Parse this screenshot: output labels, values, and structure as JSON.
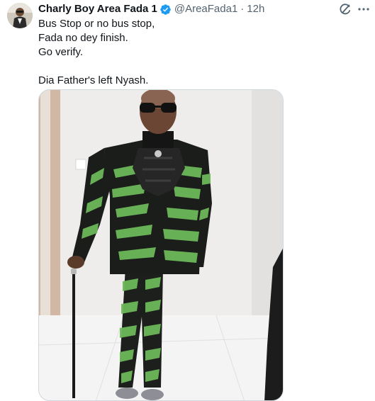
{
  "tweet": {
    "author_name": "Charly Boy Area Fada 1",
    "handle": "@AreaFada1",
    "separator": "·",
    "time": "12h",
    "lines": [
      "Bus Stop or no bus stop,",
      "Fada no dey finish.",
      "Go verify.",
      "",
      "Dia Father's left Nyash."
    ]
  },
  "icons": {
    "verified": "verified-badge-icon",
    "grok": "grok-icon",
    "more": "more-options-icon"
  },
  "colors": {
    "verified_blue": "#1d9bf0",
    "secondary_text": "#536471",
    "primary_text": "#0f1419"
  }
}
